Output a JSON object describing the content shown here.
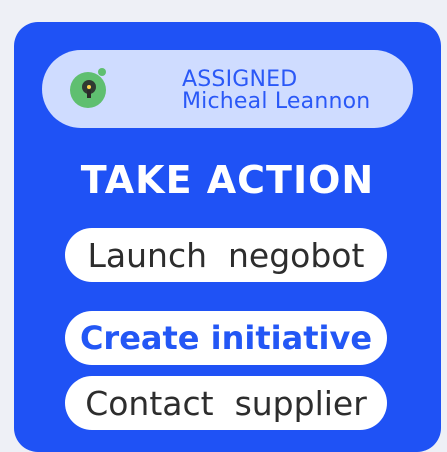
{
  "assignment": {
    "status_label": "ASSIGNED",
    "assignee_name": "Micheal Leannon",
    "avatar_icon": "person-avatar-icon"
  },
  "actions": {
    "heading": "TAKE ACTION",
    "launch_label": "Launch  negobot",
    "create_label": "Create initiative",
    "contact_label": "Contact  supplier"
  },
  "colors": {
    "panel": "#1f52f5",
    "card": "#cfdcff",
    "accent": "#2357f5",
    "button_bg": "#ffffff",
    "avatar": "#5fbf70"
  }
}
